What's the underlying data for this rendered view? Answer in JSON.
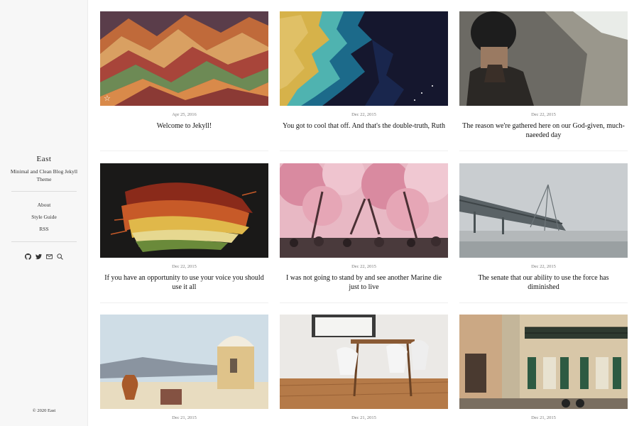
{
  "sidebar": {
    "title": "East",
    "description": "Minimal and Clean Blog Jekyll Theme",
    "nav": [
      {
        "label": "About"
      },
      {
        "label": "Style Guide"
      },
      {
        "label": "RSS"
      }
    ],
    "social": [
      "github-icon",
      "twitter-icon",
      "mail-icon",
      "search-icon"
    ],
    "copyright": "© 2020 East"
  },
  "posts": [
    {
      "date": "Apr 25, 2016",
      "title": "Welcome to Jekyll!",
      "image": "rainbow-mountains",
      "featured": true
    },
    {
      "date": "Dec 22, 2015",
      "title": "You got to cool that off. And that's the double-truth, Ruth",
      "image": "coastline-aerial"
    },
    {
      "date": "Dec 22, 2015",
      "title": "The reason we're gathered here on our God-given, much-naeeded day",
      "image": "man-with-beanie"
    },
    {
      "date": "Dec 22, 2015",
      "title": "If you have an opportunity to use your voice you should use it all",
      "image": "dried-leaves"
    },
    {
      "date": "Dec 22, 2015",
      "title": "I was not going to stand by and see another Marine die just to live",
      "image": "cherry-blossom-street"
    },
    {
      "date": "Dec 22, 2015",
      "title": "The senate that our ability to use the force has diminished",
      "image": "foggy-bridge"
    },
    {
      "date": "Dec 21, 2015",
      "title": "",
      "image": "santorini-rooftop"
    },
    {
      "date": "Dec 21, 2015",
      "title": "",
      "image": "dining-room"
    },
    {
      "date": "Dec 21, 2015",
      "title": "",
      "image": "balcony-building"
    }
  ]
}
